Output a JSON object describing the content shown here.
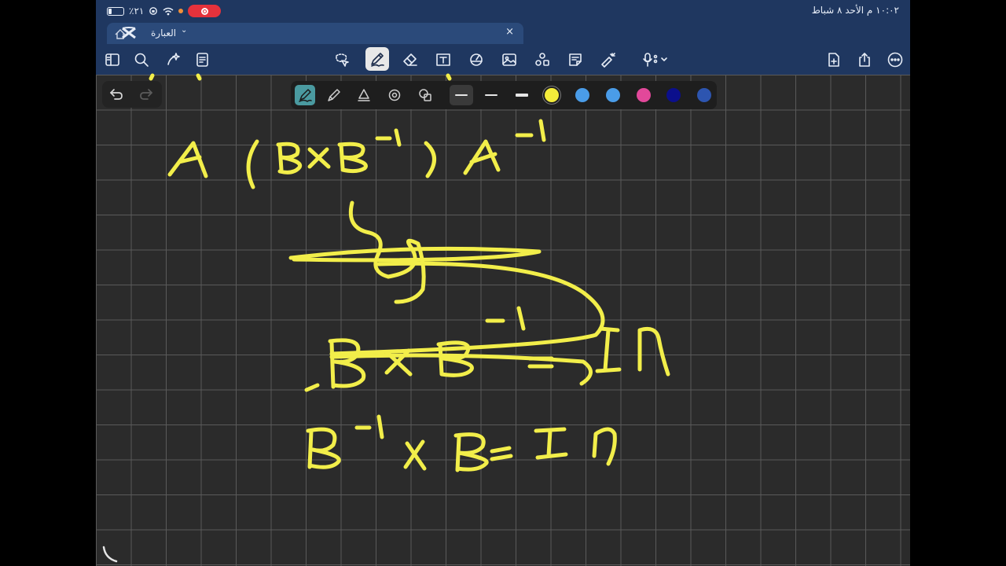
{
  "status": {
    "battery_percent": "٪٢١",
    "datetime": "١٠:٠٢ م  الأحد ٨ شباط"
  },
  "tab": {
    "title": "العبارة",
    "chevron": "⌄",
    "close": "×"
  },
  "toolbar": {
    "icons": [
      "sidebar-icon",
      "search-icon",
      "sparkle-icon",
      "document-list-icon",
      "lasso-icon",
      "pen-icon",
      "eraser-icon",
      "text-box-icon",
      "shapes-icon",
      "image-icon",
      "stickers-icon",
      "sticky-note-icon",
      "laser-pointer-icon",
      "microphone-icon",
      "add-page-icon",
      "share-icon",
      "more-icon"
    ],
    "active": "pen-icon"
  },
  "history": {
    "icons": [
      "undo-icon",
      "redo-icon"
    ],
    "redo_enabled": false
  },
  "pen_bar": {
    "tools": [
      "fountain-pen-icon",
      "ballpoint-pen-icon",
      "brush-pen-icon",
      "shape-pen-icon",
      "highlighter-options-icon"
    ],
    "active_tool": "fountain-pen-icon",
    "stroke_widths": [
      "thin",
      "medium",
      "thick"
    ],
    "active_width": "thin",
    "colors": [
      "#f4ec3a",
      "#4a9ce8",
      "#4a9ce8",
      "#e2489a",
      "#0b0f8c",
      "#2d55b0"
    ],
    "selected_color": "#f4ec3a"
  },
  "handwriting": {
    "line1": "A ( B x B⁻¹ ) A⁻¹",
    "line2": "B x B⁻¹ = In",
    "line3": "B⁻¹ x B = In"
  }
}
